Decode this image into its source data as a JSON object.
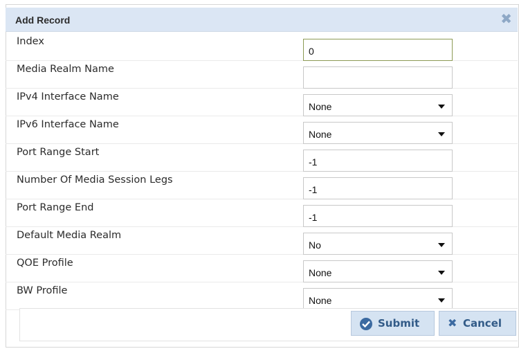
{
  "dialog": {
    "title": "Add Record",
    "close_icon": "close-icon"
  },
  "fields": [
    {
      "label": "Index",
      "value": "0",
      "type": "text",
      "active": true
    },
    {
      "label": "Media Realm Name",
      "value": "",
      "type": "text"
    },
    {
      "label": "IPv4 Interface Name",
      "value": "None",
      "type": "select"
    },
    {
      "label": "IPv6 Interface Name",
      "value": "None",
      "type": "select"
    },
    {
      "label": "Port Range Start",
      "value": "-1",
      "type": "text"
    },
    {
      "label": "Number Of Media Session Legs",
      "value": "-1",
      "type": "text"
    },
    {
      "label": "Port Range End",
      "value": "-1",
      "type": "text"
    },
    {
      "label": "Default Media Realm",
      "value": "No",
      "type": "select"
    },
    {
      "label": "QOE Profile",
      "value": "None",
      "type": "select"
    },
    {
      "label": "BW Profile",
      "value": "None",
      "type": "select"
    }
  ],
  "buttons": {
    "submit_label": "Submit",
    "cancel_label": "Cancel"
  }
}
